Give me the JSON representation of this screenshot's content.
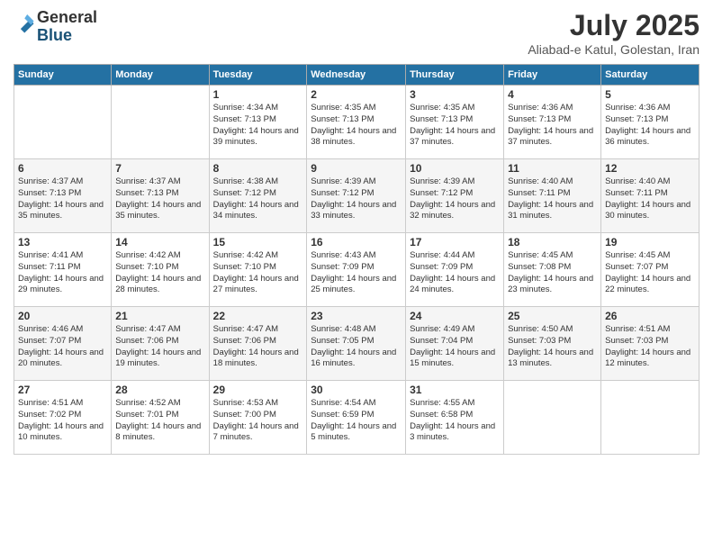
{
  "logo": {
    "general": "General",
    "blue": "Blue"
  },
  "header": {
    "title": "July 2025",
    "subtitle": "Aliabad-e Katul, Golestan, Iran"
  },
  "weekdays": [
    "Sunday",
    "Monday",
    "Tuesday",
    "Wednesday",
    "Thursday",
    "Friday",
    "Saturday"
  ],
  "weeks": [
    [
      {
        "num": "",
        "sunrise": "",
        "sunset": "",
        "daylight": "",
        "empty": true
      },
      {
        "num": "",
        "sunrise": "",
        "sunset": "",
        "daylight": "",
        "empty": true
      },
      {
        "num": "1",
        "sunrise": "Sunrise: 4:34 AM",
        "sunset": "Sunset: 7:13 PM",
        "daylight": "Daylight: 14 hours and 39 minutes."
      },
      {
        "num": "2",
        "sunrise": "Sunrise: 4:35 AM",
        "sunset": "Sunset: 7:13 PM",
        "daylight": "Daylight: 14 hours and 38 minutes."
      },
      {
        "num": "3",
        "sunrise": "Sunrise: 4:35 AM",
        "sunset": "Sunset: 7:13 PM",
        "daylight": "Daylight: 14 hours and 37 minutes."
      },
      {
        "num": "4",
        "sunrise": "Sunrise: 4:36 AM",
        "sunset": "Sunset: 7:13 PM",
        "daylight": "Daylight: 14 hours and 37 minutes."
      },
      {
        "num": "5",
        "sunrise": "Sunrise: 4:36 AM",
        "sunset": "Sunset: 7:13 PM",
        "daylight": "Daylight: 14 hours and 36 minutes."
      }
    ],
    [
      {
        "num": "6",
        "sunrise": "Sunrise: 4:37 AM",
        "sunset": "Sunset: 7:13 PM",
        "daylight": "Daylight: 14 hours and 35 minutes."
      },
      {
        "num": "7",
        "sunrise": "Sunrise: 4:37 AM",
        "sunset": "Sunset: 7:13 PM",
        "daylight": "Daylight: 14 hours and 35 minutes."
      },
      {
        "num": "8",
        "sunrise": "Sunrise: 4:38 AM",
        "sunset": "Sunset: 7:12 PM",
        "daylight": "Daylight: 14 hours and 34 minutes."
      },
      {
        "num": "9",
        "sunrise": "Sunrise: 4:39 AM",
        "sunset": "Sunset: 7:12 PM",
        "daylight": "Daylight: 14 hours and 33 minutes."
      },
      {
        "num": "10",
        "sunrise": "Sunrise: 4:39 AM",
        "sunset": "Sunset: 7:12 PM",
        "daylight": "Daylight: 14 hours and 32 minutes."
      },
      {
        "num": "11",
        "sunrise": "Sunrise: 4:40 AM",
        "sunset": "Sunset: 7:11 PM",
        "daylight": "Daylight: 14 hours and 31 minutes."
      },
      {
        "num": "12",
        "sunrise": "Sunrise: 4:40 AM",
        "sunset": "Sunset: 7:11 PM",
        "daylight": "Daylight: 14 hours and 30 minutes."
      }
    ],
    [
      {
        "num": "13",
        "sunrise": "Sunrise: 4:41 AM",
        "sunset": "Sunset: 7:11 PM",
        "daylight": "Daylight: 14 hours and 29 minutes."
      },
      {
        "num": "14",
        "sunrise": "Sunrise: 4:42 AM",
        "sunset": "Sunset: 7:10 PM",
        "daylight": "Daylight: 14 hours and 28 minutes."
      },
      {
        "num": "15",
        "sunrise": "Sunrise: 4:42 AM",
        "sunset": "Sunset: 7:10 PM",
        "daylight": "Daylight: 14 hours and 27 minutes."
      },
      {
        "num": "16",
        "sunrise": "Sunrise: 4:43 AM",
        "sunset": "Sunset: 7:09 PM",
        "daylight": "Daylight: 14 hours and 25 minutes."
      },
      {
        "num": "17",
        "sunrise": "Sunrise: 4:44 AM",
        "sunset": "Sunset: 7:09 PM",
        "daylight": "Daylight: 14 hours and 24 minutes."
      },
      {
        "num": "18",
        "sunrise": "Sunrise: 4:45 AM",
        "sunset": "Sunset: 7:08 PM",
        "daylight": "Daylight: 14 hours and 23 minutes."
      },
      {
        "num": "19",
        "sunrise": "Sunrise: 4:45 AM",
        "sunset": "Sunset: 7:07 PM",
        "daylight": "Daylight: 14 hours and 22 minutes."
      }
    ],
    [
      {
        "num": "20",
        "sunrise": "Sunrise: 4:46 AM",
        "sunset": "Sunset: 7:07 PM",
        "daylight": "Daylight: 14 hours and 20 minutes."
      },
      {
        "num": "21",
        "sunrise": "Sunrise: 4:47 AM",
        "sunset": "Sunset: 7:06 PM",
        "daylight": "Daylight: 14 hours and 19 minutes."
      },
      {
        "num": "22",
        "sunrise": "Sunrise: 4:47 AM",
        "sunset": "Sunset: 7:06 PM",
        "daylight": "Daylight: 14 hours and 18 minutes."
      },
      {
        "num": "23",
        "sunrise": "Sunrise: 4:48 AM",
        "sunset": "Sunset: 7:05 PM",
        "daylight": "Daylight: 14 hours and 16 minutes."
      },
      {
        "num": "24",
        "sunrise": "Sunrise: 4:49 AM",
        "sunset": "Sunset: 7:04 PM",
        "daylight": "Daylight: 14 hours and 15 minutes."
      },
      {
        "num": "25",
        "sunrise": "Sunrise: 4:50 AM",
        "sunset": "Sunset: 7:03 PM",
        "daylight": "Daylight: 14 hours and 13 minutes."
      },
      {
        "num": "26",
        "sunrise": "Sunrise: 4:51 AM",
        "sunset": "Sunset: 7:03 PM",
        "daylight": "Daylight: 14 hours and 12 minutes."
      }
    ],
    [
      {
        "num": "27",
        "sunrise": "Sunrise: 4:51 AM",
        "sunset": "Sunset: 7:02 PM",
        "daylight": "Daylight: 14 hours and 10 minutes."
      },
      {
        "num": "28",
        "sunrise": "Sunrise: 4:52 AM",
        "sunset": "Sunset: 7:01 PM",
        "daylight": "Daylight: 14 hours and 8 minutes."
      },
      {
        "num": "29",
        "sunrise": "Sunrise: 4:53 AM",
        "sunset": "Sunset: 7:00 PM",
        "daylight": "Daylight: 14 hours and 7 minutes."
      },
      {
        "num": "30",
        "sunrise": "Sunrise: 4:54 AM",
        "sunset": "Sunset: 6:59 PM",
        "daylight": "Daylight: 14 hours and 5 minutes."
      },
      {
        "num": "31",
        "sunrise": "Sunrise: 4:55 AM",
        "sunset": "Sunset: 6:58 PM",
        "daylight": "Daylight: 14 hours and 3 minutes."
      },
      {
        "num": "",
        "sunrise": "",
        "sunset": "",
        "daylight": "",
        "empty": true
      },
      {
        "num": "",
        "sunrise": "",
        "sunset": "",
        "daylight": "",
        "empty": true
      }
    ]
  ]
}
